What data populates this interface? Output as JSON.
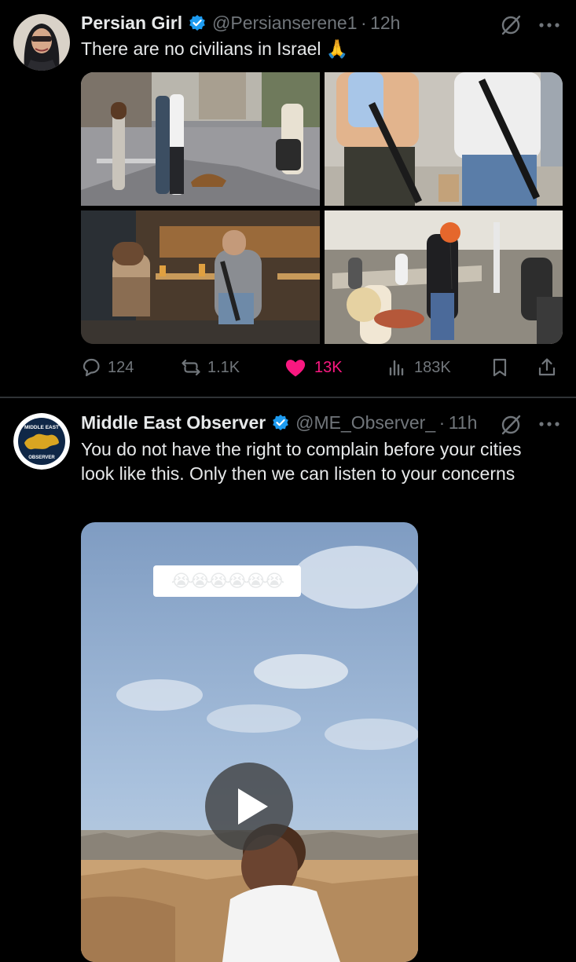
{
  "tweets": [
    {
      "author_name": "Persian Girl",
      "handle": "@Persianserene1",
      "separator": "·",
      "time": "12h",
      "text": "There are no civilians in Israel 🙏",
      "stats": {
        "replies": "124",
        "reposts": "1.1K",
        "likes": "13K",
        "views": "183K"
      },
      "media_images": [
        "street-scene-photo",
        "armed-men-backs-photo",
        "cafe-table-photo",
        "plaza-crowd-photo"
      ]
    },
    {
      "author_name": "Middle East Observer",
      "handle": "@ME_Observer_",
      "separator": "·",
      "time": "11h",
      "text": "You do not have the right to complain before your cities look like this. Only then we can listen to your concerns",
      "video_caption": "😭😭😭😭😭😭",
      "avatar_text_top": "MIDDLE EAST",
      "avatar_text_bottom": "OBSERVER"
    }
  ],
  "colors": {
    "background": "#000000",
    "text": "#e7e9ea",
    "secondary_text": "#71767b",
    "like": "#f91880",
    "verified": "#1d9bf0"
  },
  "icons": [
    "verified-icon",
    "grok-icon",
    "more-icon",
    "reply-icon",
    "repost-icon",
    "like-icon",
    "views-icon",
    "bookmark-icon",
    "share-icon",
    "play-icon"
  ]
}
